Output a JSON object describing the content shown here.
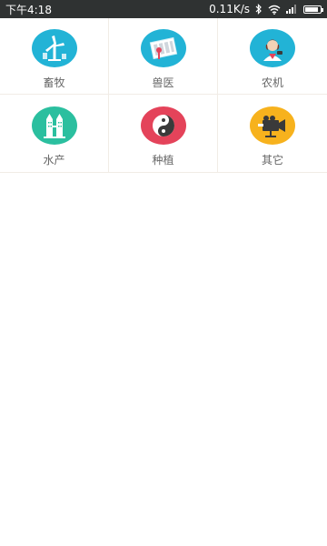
{
  "status_bar": {
    "time": "下午4:18",
    "network_speed": "0.11K/s",
    "icons": [
      "bluetooth-icon",
      "wifi-icon",
      "signal-icon",
      "battery-icon"
    ],
    "battery_level": 0.85
  },
  "colors": {
    "status_bg": "#2f3232",
    "blue": "#22b3d6",
    "green": "#2bbf9f",
    "red": "#e4435a",
    "orange": "#f7b21d"
  },
  "categories": [
    {
      "label": "畜牧",
      "icon": "windmill-icon",
      "color": "#22b3d6"
    },
    {
      "label": "兽医",
      "icon": "vet-tools-icon",
      "color": "#22b3d6"
    },
    {
      "label": "农机",
      "icon": "farmer-icon",
      "color": "#22b3d6"
    },
    {
      "label": "水产",
      "icon": "buildings-icon",
      "color": "#2bbf9f"
    },
    {
      "label": "种植",
      "icon": "yin-yang-icon",
      "color": "#e4435a"
    },
    {
      "label": "其它",
      "icon": "camera-icon",
      "color": "#f7b21d"
    }
  ]
}
